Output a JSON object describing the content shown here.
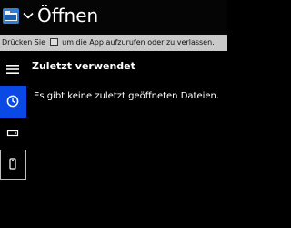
{
  "titlebar": {
    "app_icon": "folder-icon",
    "chevron_icon": "chevron-down-icon",
    "title": "Öffnen"
  },
  "hint": {
    "before_key": "Drücken Sie",
    "key_icon": "keyboard-key-icon",
    "after_key": "um die App aufzurufen oder zu verlassen."
  },
  "nav": {
    "menu_icon": "hamburger-menu-icon",
    "items": [
      {
        "icon": "clock-icon",
        "selected": true
      },
      {
        "icon": "drive-icon",
        "selected": false
      },
      {
        "icon": "phone-icon",
        "selected": false
      }
    ]
  },
  "main": {
    "heading": "Zuletzt verwendet",
    "empty_message": "Es gibt keine zuletzt geöffneten Dateien."
  },
  "colors": {
    "background": "#000000",
    "hint_bar": "#c9c9c9",
    "accent": "#0a49e6"
  }
}
